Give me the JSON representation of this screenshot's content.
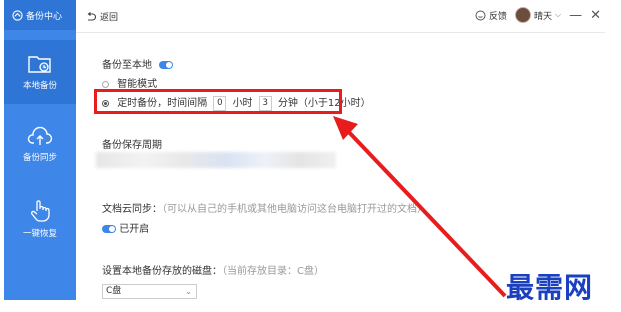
{
  "sidebar": {
    "header_label": "备份中心",
    "items": [
      {
        "label": "本地备份",
        "icon": "folder-clock-icon"
      },
      {
        "label": "备份同步",
        "icon": "cloud-upload-icon"
      },
      {
        "label": "一键恢复",
        "icon": "hand-pointer-icon"
      }
    ]
  },
  "topbar": {
    "back_label": "返回",
    "feedback_label": "反馈",
    "user_name": "晴天",
    "minimize": "—",
    "close": "✕"
  },
  "local_backup": {
    "title": "备份至本地",
    "smart_mode": "智能模式",
    "timed_prefix": "定时备份，时间间隔",
    "hours_value": "0",
    "hours_unit": "小时",
    "minutes_value": "3",
    "minutes_suffix": "分钟（小于12小时）"
  },
  "retention": {
    "title": "备份保存周期"
  },
  "cloud_sync": {
    "title": "文档云同步：",
    "hint": "（可以从自己的手机或其他电脑访问这台电脑打开过的文档）",
    "status": "已开启"
  },
  "disk": {
    "title": "设置本地备份存放的磁盘：",
    "hint": "（当前存放目录：C盘）",
    "selected": "C盘"
  },
  "watermark": "最需网",
  "colors": {
    "sidebar": "#3e86e8",
    "highlight": "#e81c1c",
    "watermark": "#1a3fbf"
  }
}
